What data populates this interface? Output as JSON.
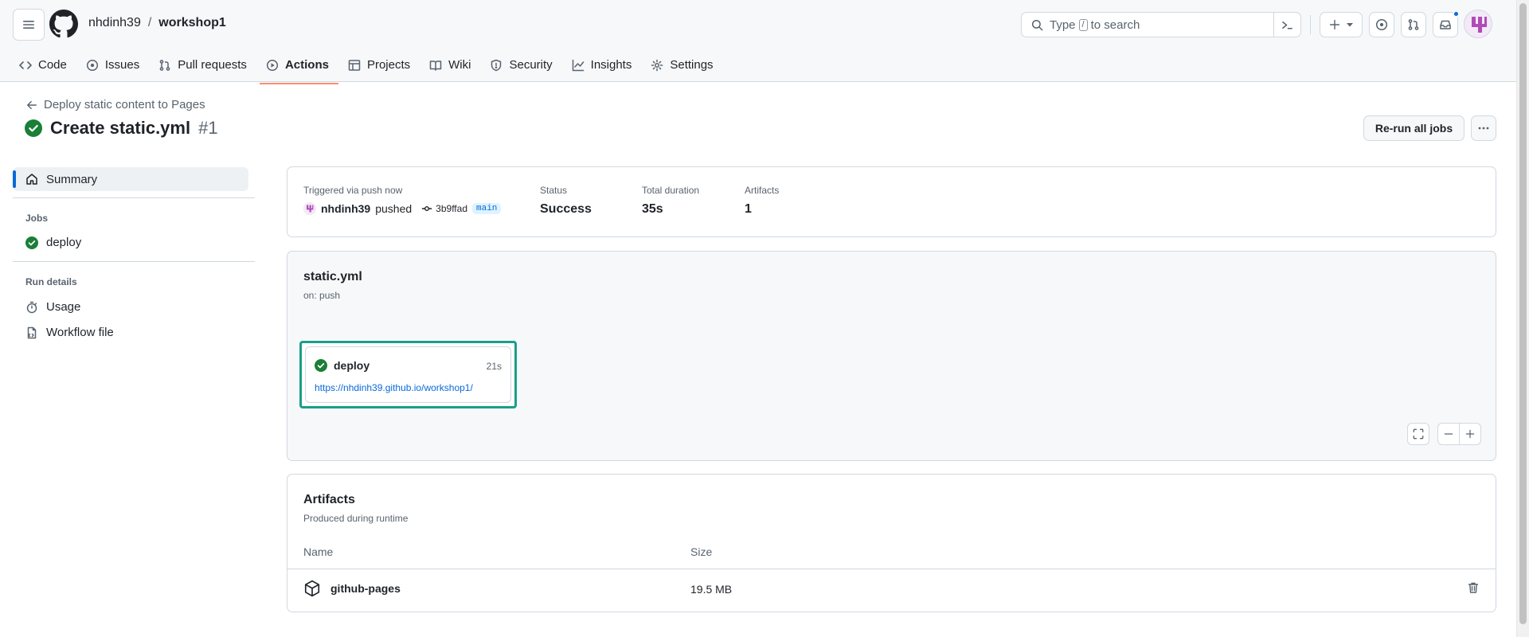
{
  "header": {
    "owner": "nhdinh39",
    "separator": "/",
    "repo": "workshop1",
    "search_text_before": "Type",
    "search_key": "/",
    "search_text_after": "to search"
  },
  "tabs": [
    {
      "label": "Code",
      "icon": "code-icon"
    },
    {
      "label": "Issues",
      "icon": "issue-icon"
    },
    {
      "label": "Pull requests",
      "icon": "pull-request-icon"
    },
    {
      "label": "Actions",
      "icon": "play-icon"
    },
    {
      "label": "Projects",
      "icon": "table-icon"
    },
    {
      "label": "Wiki",
      "icon": "book-icon"
    },
    {
      "label": "Security",
      "icon": "shield-icon"
    },
    {
      "label": "Insights",
      "icon": "graph-icon"
    },
    {
      "label": "Settings",
      "icon": "gear-icon"
    }
  ],
  "run": {
    "back_label": "Deploy static content to Pages",
    "title": "Create static.yml",
    "number": "#1",
    "rerun_label": "Re-run all jobs"
  },
  "sidebar": {
    "summary_label": "Summary",
    "jobs_heading": "Jobs",
    "job_label": "deploy",
    "details_heading": "Run details",
    "usage_label": "Usage",
    "workflow_file_label": "Workflow file"
  },
  "trigger": {
    "label": "Triggered via push now",
    "user": "nhdinh39",
    "action": "pushed",
    "sha": "3b9ffad",
    "branch": "main",
    "status_label": "Status",
    "status_value": "Success",
    "duration_label": "Total duration",
    "duration_value": "35s",
    "artifacts_label": "Artifacts",
    "artifacts_value": "1"
  },
  "graph": {
    "workflow_name": "static.yml",
    "trigger": "on: push",
    "job_name": "deploy",
    "job_time": "21s",
    "job_url": "https://nhdinh39.github.io/workshop1/"
  },
  "artifacts": {
    "title": "Artifacts",
    "subtitle": "Produced during runtime",
    "col_name": "Name",
    "col_size": "Size",
    "rows": [
      {
        "name": "github-pages",
        "size": "19.5 MB"
      }
    ]
  },
  "colors": {
    "success": "#1a7f37",
    "link": "#0969da",
    "active_tab_underline": "#fd8c73",
    "selected_job_border": "#1a9e8a"
  }
}
